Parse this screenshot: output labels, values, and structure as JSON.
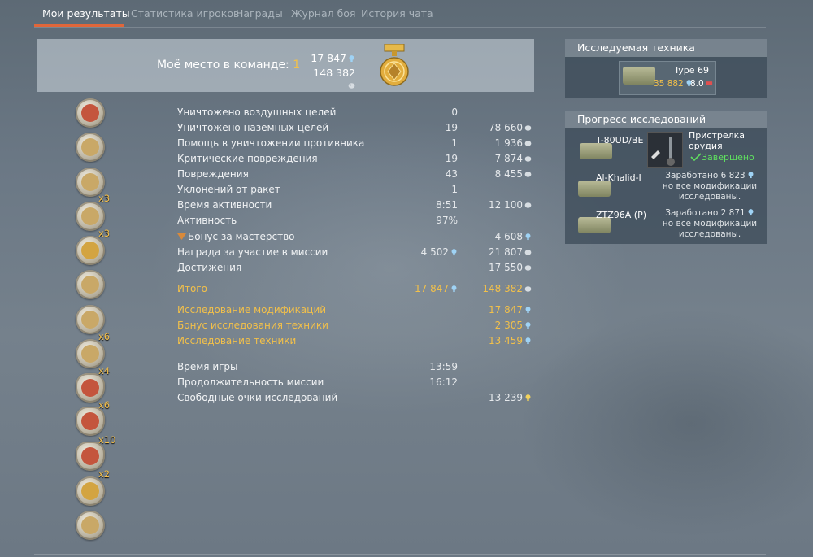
{
  "tabs": [
    {
      "label": "Мои результаты",
      "active": true
    },
    {
      "label": "Статистика игроков",
      "active": false
    },
    {
      "label": "Награды",
      "active": false
    },
    {
      "label": "Журнал боя",
      "active": false
    },
    {
      "label": "История чата",
      "active": false
    }
  ],
  "header": {
    "place_label": "Моё место в команде:",
    "place_value": "1",
    "research_points": "17 847",
    "silver_lions": "148 382"
  },
  "awards": [
    {
      "icon": "wings-medal-icon",
      "multiplier": ""
    },
    {
      "icon": "wreath-medal-icon",
      "multiplier": ""
    },
    {
      "icon": "helmet-medal-icon",
      "multiplier": "x3"
    },
    {
      "icon": "eagle-medal-icon",
      "multiplier": "x3"
    },
    {
      "icon": "gear-shield-medal-icon",
      "multiplier": ""
    },
    {
      "icon": "globe-medal-icon",
      "multiplier": ""
    },
    {
      "icon": "crossed-swords-medal-icon",
      "multiplier": "x6"
    },
    {
      "icon": "fist-medal-icon",
      "multiplier": "x4"
    },
    {
      "icon": "multi-kill-badge-icon",
      "multiplier": "x6"
    },
    {
      "icon": "shield-swords-badge-icon",
      "multiplier": "x10"
    },
    {
      "icon": "multi-kill-badge-2-icon",
      "multiplier": "x2"
    },
    {
      "icon": "gold-tank-medal-icon",
      "multiplier": ""
    },
    {
      "icon": "silver-wings-medal-icon",
      "multiplier": ""
    }
  ],
  "stats": [
    {
      "label": "Уничтожено воздушных целей",
      "v1": "0",
      "v2": "",
      "v1_icon": "",
      "v2_icon": ""
    },
    {
      "label": "Уничтожено наземных целей",
      "v1": "19",
      "v2": "78 660",
      "v1_icon": "",
      "v2_icon": "silver"
    },
    {
      "label": "Помощь в уничтожении противника",
      "v1": "1",
      "v2": "1 936",
      "v1_icon": "",
      "v2_icon": "silver"
    },
    {
      "label": "Критические повреждения",
      "v1": "19",
      "v2": "7 874",
      "v1_icon": "",
      "v2_icon": "silver"
    },
    {
      "label": "Повреждения",
      "v1": "43",
      "v2": "8 455",
      "v1_icon": "",
      "v2_icon": "silver"
    },
    {
      "label": "Уклонений от ракет",
      "v1": "1",
      "v2": "",
      "v1_icon": "",
      "v2_icon": ""
    },
    {
      "label": "Время активности",
      "v1": "8:51",
      "v2": "12 100",
      "v1_icon": "",
      "v2_icon": "silver"
    },
    {
      "label": "Активность",
      "v1": "97%",
      "v2": "",
      "v1_icon": "",
      "v2_icon": ""
    },
    {
      "label": "Бонус за мастерство",
      "v1": "",
      "v2": "4 608",
      "v1_icon": "",
      "v2_icon": "rp",
      "lead_icon": true
    },
    {
      "label": "Награда за участие в миссии",
      "v1": "4 502",
      "v2": "21 807",
      "v1_icon": "rp",
      "v2_icon": "silver"
    },
    {
      "label": "Достижения",
      "v1": "",
      "v2": "17 550",
      "v1_icon": "",
      "v2_icon": "silver"
    }
  ],
  "total": {
    "label": "Итого",
    "v1": "17 847",
    "v2": "148 382"
  },
  "research": [
    {
      "label": "Исследование модификаций",
      "v2": "17 847"
    },
    {
      "label": "Бонус исследования техники",
      "v2": "2 305"
    },
    {
      "label": "Исследование техники",
      "v2": "13 459"
    }
  ],
  "misc": [
    {
      "label": "Время игры",
      "v1": "13:59",
      "v2": "",
      "v2_icon": ""
    },
    {
      "label": "Продолжительность миссии",
      "v1": "16:12",
      "v2": "",
      "v2_icon": ""
    },
    {
      "label": "Свободные очки исследований",
      "v1": "",
      "v2": "13 239",
      "v2_icon": "frp"
    }
  ],
  "researched_panel": {
    "title": "Исследуемая техника",
    "vehicle": "Type 69",
    "rp": "35 882",
    "br": "8.0"
  },
  "progress_panel": {
    "title": "Прогресс исследований",
    "items": [
      {
        "vehicle": "T-80UD/BE",
        "module": "Пристрелка орудия",
        "status": "Завершено"
      },
      {
        "vehicle": "Al-Khalid-I",
        "earned_label": "Заработано 6 823",
        "note": "но все модификации исследованы."
      },
      {
        "vehicle": "ZTZ96A (P)",
        "earned_label": "Заработано 2 871",
        "note": "но все модификации исследованы."
      }
    ]
  },
  "colors": {
    "accent": "#e0663a",
    "gold": "#f2c04a",
    "green": "#5fe05f"
  }
}
